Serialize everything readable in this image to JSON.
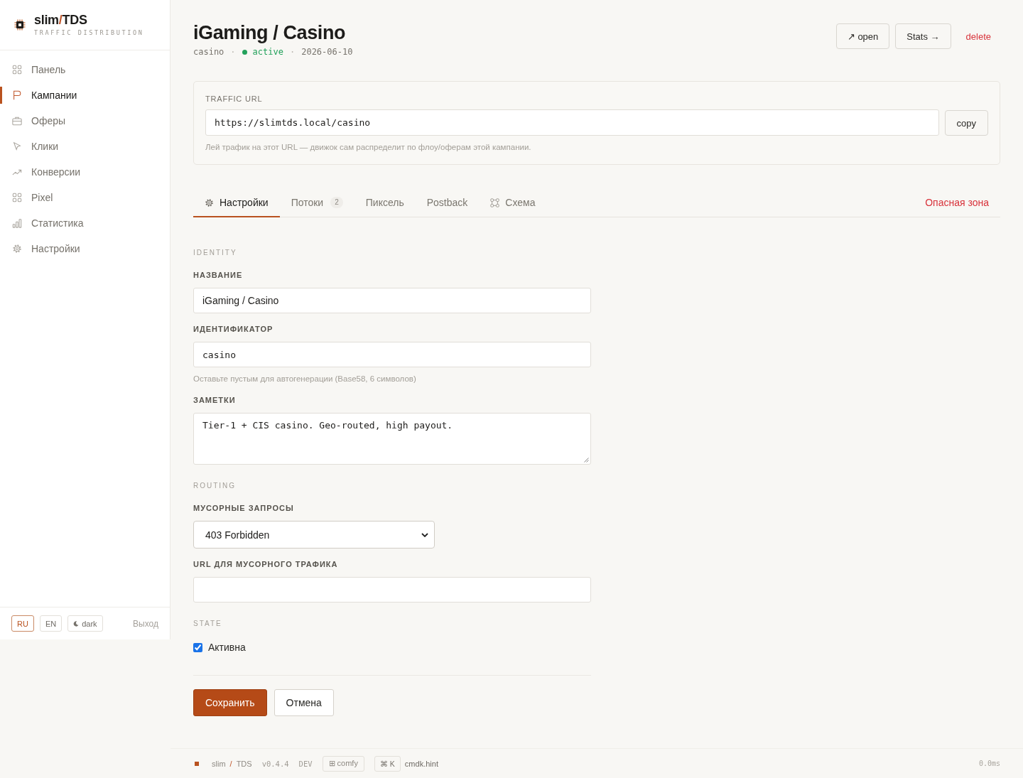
{
  "sidebar": {
    "brand": [
      {
        "text": "slim",
        "accent": false
      },
      {
        "text": "/",
        "accent": true
      },
      {
        "text": "TDS",
        "accent": false
      }
    ],
    "tagline": "TRAFFIC DISTRIBUTION",
    "nav": [
      {
        "label": "Панель",
        "selected": false
      },
      {
        "label": "Кампании",
        "selected": true
      },
      {
        "label": "Оферы",
        "selected": false
      },
      {
        "label": "Клики",
        "selected": false
      },
      {
        "label": "Конверсии",
        "selected": false
      },
      {
        "label": "Pixel",
        "selected": false
      },
      {
        "label": "Статистика",
        "selected": false
      },
      {
        "label": "Настройки",
        "selected": false
      }
    ],
    "languages": [
      {
        "label": "RU",
        "selected": true
      },
      {
        "label": "EN",
        "selected": false
      }
    ],
    "theme_button": "dark",
    "logout": "Выход"
  },
  "header": {
    "title": "iGaming / Casino",
    "meta": [
      {
        "kind": "text",
        "text": "casino"
      },
      {
        "kind": "separator",
        "text": "·"
      },
      {
        "kind": "status",
        "text": "active",
        "on": true
      },
      {
        "kind": "separator",
        "text": "·"
      },
      {
        "kind": "text",
        "text": "2026-06-10"
      }
    ],
    "actions": [
      {
        "kind": "button",
        "label": "↗ open"
      },
      {
        "kind": "button",
        "label": "Stats →"
      },
      {
        "kind": "danger",
        "label": "delete"
      }
    ]
  },
  "traffic_url": {
    "label": "TRAFFIC URL",
    "value": "https://slimtds.local/casino",
    "copy_button": "copy",
    "hint": "Лей трафик на этот URL — движок сам распределит по флоу/оферам этой кампании."
  },
  "tabs": [
    {
      "kind": "normal",
      "label": "Настройки",
      "selected": true
    },
    {
      "kind": "normal",
      "label": "Потоки",
      "badge": "2",
      "selected": false
    },
    {
      "kind": "normal",
      "label": "Пиксель",
      "selected": false
    },
    {
      "kind": "normal",
      "label": "Postback",
      "selected": false
    },
    {
      "kind": "normal",
      "label": "Схема",
      "selected": false
    },
    {
      "kind": "danger",
      "label": "Опасная зона",
      "selected": false
    }
  ],
  "form": {
    "sections": [
      {
        "heading": "IDENTITY",
        "fields": [
          {
            "kind": "text",
            "label": "НАЗВАНИЕ",
            "value": "iGaming / Casino"
          },
          {
            "kind": "mono",
            "label": "ИДЕНТИФИКАТОР",
            "value": "casino",
            "hint": "Оставьте пустым для автогенерации (Base58, 6 символов)"
          },
          {
            "kind": "textarea",
            "label": "ЗАМЕТКИ",
            "value": "Tier-1 + CIS casino. Geo-routed, high payout."
          }
        ]
      },
      {
        "heading": "ROUTING",
        "fields": [
          {
            "kind": "select",
            "label": "МУСОРНЫЕ ЗАПРОСЫ",
            "value": "403 Forbidden"
          },
          {
            "kind": "mono",
            "label": "URL ДЛЯ МУСОРНОГО ТРАФИКА"
          }
        ]
      },
      {
        "heading": "STATE",
        "fields": [
          {
            "kind": "checkbox",
            "label": "Активна",
            "checked": true
          }
        ]
      }
    ],
    "buttons": [
      {
        "kind": "primary",
        "label": "Сохранить"
      },
      {
        "kind": "secondary",
        "label": "Отмена"
      }
    ]
  },
  "footer": {
    "brand": [
      {
        "text": "slim",
        "accent": false
      },
      {
        "text": "/",
        "accent": true
      },
      {
        "text": "TDS",
        "accent": false
      }
    ],
    "version": "v0.4.4",
    "env": "DEV",
    "density": "⊞ comfy",
    "shortcut": "⌘ K",
    "shortcut_hint": "cmdk.hint",
    "timing": "0.0ms"
  }
}
